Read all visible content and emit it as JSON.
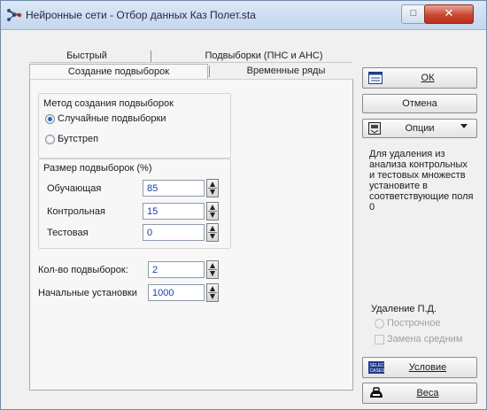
{
  "window": {
    "title": "Нейронные сети - Отбор данных Каз Полет.sta",
    "minimize_label": "□",
    "close_label": "✕"
  },
  "tabs": {
    "row1": [
      "Быстрый",
      "Подвыборки (ПНС и АНС)"
    ],
    "row2": [
      "Создание подвыборок",
      "Временные ряды"
    ]
  },
  "method": {
    "title": "Метод создания подвыборок",
    "options": [
      {
        "label": "Случайные подвыборки",
        "checked": true
      },
      {
        "label": "Бутстреп",
        "checked": false
      }
    ]
  },
  "sizes": {
    "title": "Размер подвыборок (%)",
    "rows": [
      {
        "label": "Обучающая",
        "value": "85"
      },
      {
        "label": "Контрольная",
        "value": "15"
      },
      {
        "label": "Тестовая",
        "value": "0"
      }
    ]
  },
  "counts": {
    "rows": [
      {
        "label": "Кол-во подвыборок:",
        "value": "2"
      },
      {
        "label": "Начальные установки",
        "value": "1000"
      }
    ]
  },
  "buttons": {
    "ok": "ОК",
    "cancel": "Отмена",
    "options": "Опции",
    "condition": "Условие",
    "weights": "Веса"
  },
  "hint": "Для удаления из анализа контрольных и тестовых множеств установите в соответствующие поля 0",
  "removal": {
    "title": "Удаление П.Д.",
    "options": [
      "Построчное",
      "Замена средним"
    ]
  },
  "icons": {
    "app": "neural-network-icon",
    "ok": "form-icon",
    "options": "options-icon",
    "condition": "select-cases-icon",
    "weights": "weights-icon"
  }
}
